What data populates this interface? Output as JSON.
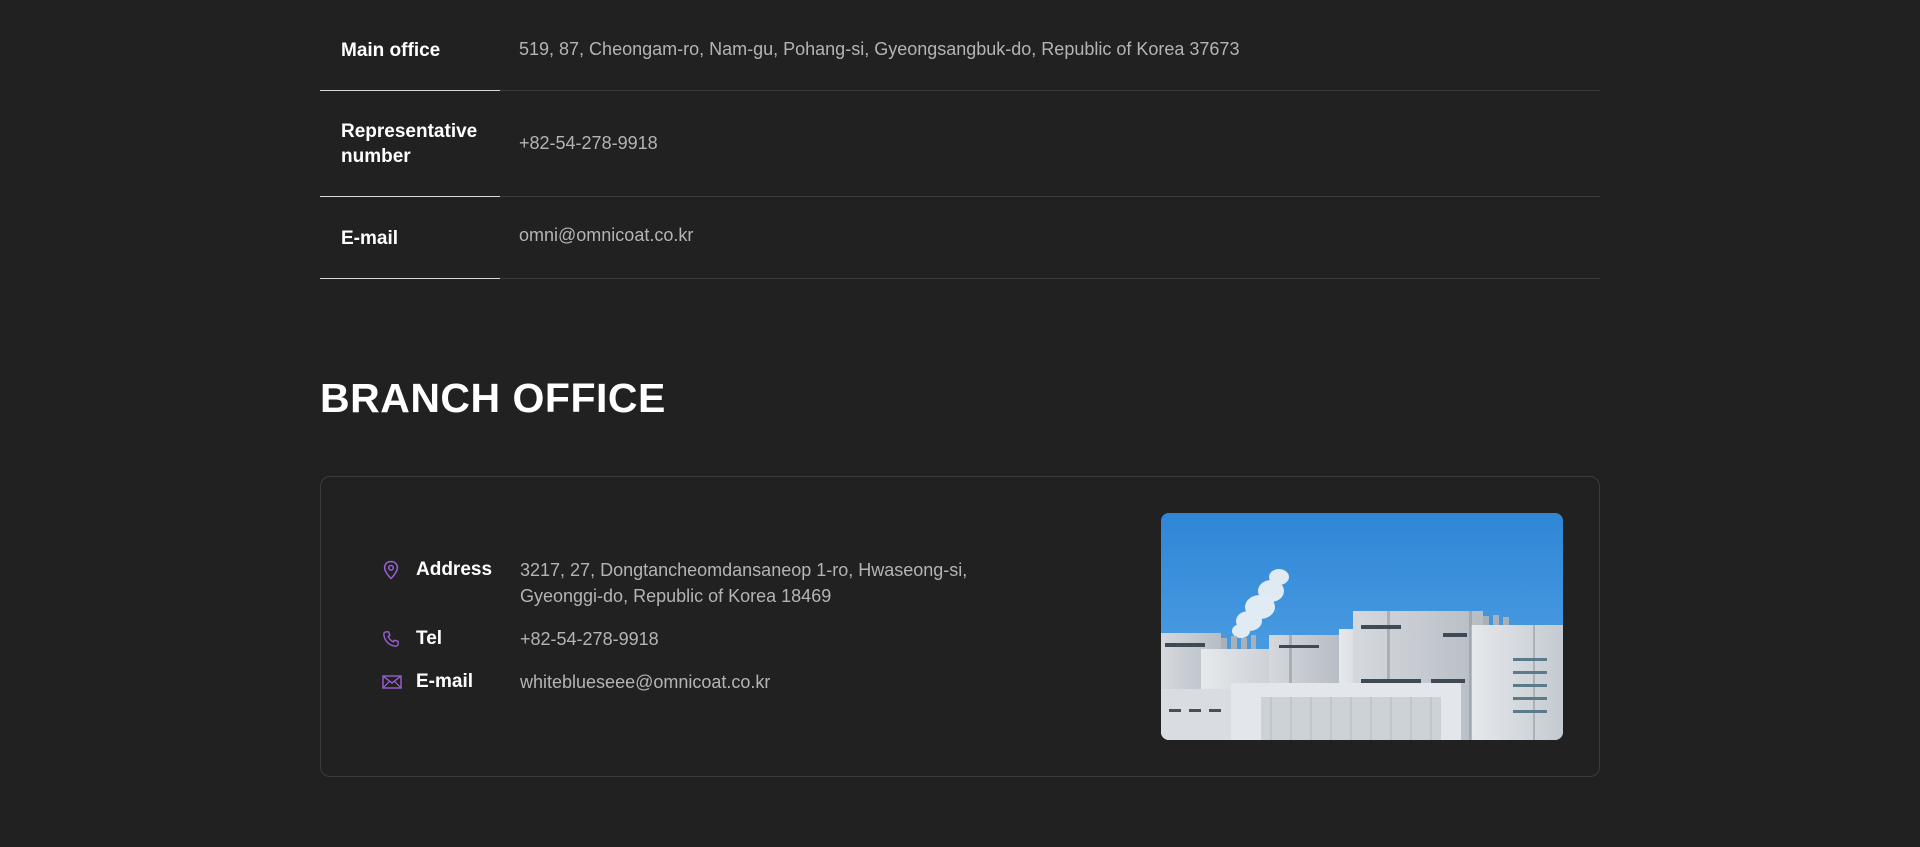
{
  "main_office": {
    "rows": [
      {
        "label": "Main office",
        "value": "519, 87, Cheongam-ro, Nam-gu, Pohang-si, Gyeongsangbuk-do, Republic of Korea 37673"
      },
      {
        "label": "Representative number",
        "value": "+82-54-278-9918"
      },
      {
        "label": "E-mail",
        "value": "omni@omnicoat.co.kr"
      }
    ]
  },
  "branch": {
    "title": "BRANCH OFFICE",
    "accent_color": "#9b5fd6",
    "items": [
      {
        "icon": "map-pin-icon",
        "label": "Address",
        "value": "3217, 27, Dongtancheomdansaneop 1-ro, Hwaseong-si, Gyeonggi-do, Republic of Korea 18469"
      },
      {
        "icon": "phone-icon",
        "label": "Tel",
        "value": "+82-54-278-9918"
      },
      {
        "icon": "mail-icon",
        "label": "E-mail",
        "value": "whiteblueseee@omnicoat.co.kr"
      }
    ]
  }
}
